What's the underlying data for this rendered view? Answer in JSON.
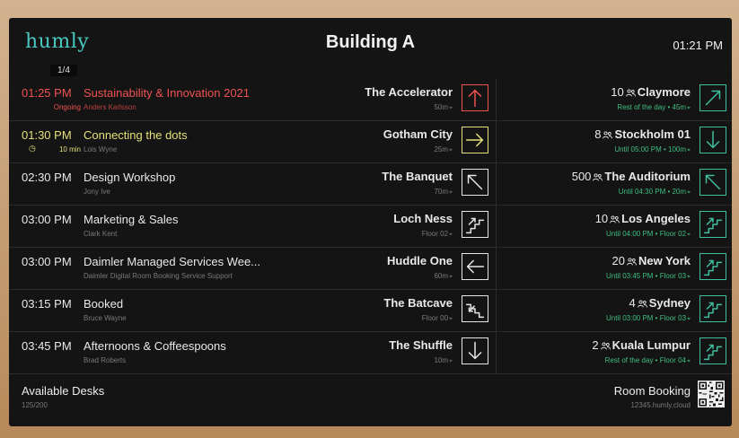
{
  "header": {
    "logo": "humly",
    "title": "Building A",
    "clock": "01:21 PM",
    "pager": "1/4"
  },
  "events": [
    {
      "time": "01:25 PM",
      "title": "Sustainability & Innovation 2021",
      "status": "Ongoing",
      "organizer": "Anders Karlsson",
      "room": "The Accelerator",
      "room_info": "50m",
      "arrow": "up",
      "state": "ongoing"
    },
    {
      "time": "01:30 PM",
      "title": "Connecting the dots",
      "status": "10 min",
      "organizer": "Lois Wyne",
      "room": "Gotham City",
      "room_info": "25m",
      "arrow": "right",
      "state": "soon"
    },
    {
      "time": "02:30 PM",
      "title": "Design Workshop",
      "status": "",
      "organizer": "Jony Ive",
      "room": "The Banquet",
      "room_info": "70m",
      "arrow": "up-left",
      "state": "normal"
    },
    {
      "time": "03:00 PM",
      "title": "Marketing & Sales",
      "status": "",
      "organizer": "Clark Kent",
      "room": "Loch Ness",
      "room_info": "Floor 02",
      "arrow": "stairs-up",
      "state": "normal"
    },
    {
      "time": "03:00 PM",
      "title": "Daimler Managed Services Wee...",
      "status": "",
      "organizer": "Daimler Digital Room Booking Service Support",
      "room": "Huddle One",
      "room_info": "60m",
      "arrow": "left",
      "state": "normal"
    },
    {
      "time": "03:15 PM",
      "title": "Booked",
      "status": "",
      "organizer": "Bruce Wayne",
      "room": "The Batcave",
      "room_info": "Floor 00",
      "arrow": "stairs-down",
      "state": "normal"
    },
    {
      "time": "03:45 PM",
      "title": "Afternoons & Coffeespoons",
      "status": "",
      "organizer": "Brad Roberts",
      "room": "The Shuffle",
      "room_info": "10m",
      "arrow": "down",
      "state": "normal"
    }
  ],
  "rooms": [
    {
      "capacity": "10",
      "name": "Claymore",
      "availability": "Rest of the day • 45m",
      "arrow": "up-right"
    },
    {
      "capacity": "8",
      "name": "Stockholm 01",
      "availability": "Until 05:00 PM • 100m",
      "arrow": "down"
    },
    {
      "capacity": "500",
      "name": "The Auditorium",
      "availability": "Until 04:30 PM • 20m",
      "arrow": "up-left"
    },
    {
      "capacity": "10",
      "name": "Los Angeles",
      "availability": "Until 04:00 PM • Floor 02",
      "arrow": "stairs-up"
    },
    {
      "capacity": "20",
      "name": "New York",
      "availability": "Until 03:45 PM • Floor 03",
      "arrow": "stairs-up"
    },
    {
      "capacity": "4",
      "name": "Sydney",
      "availability": "Until 03:00 PM • Floor 03",
      "arrow": "stairs-up"
    },
    {
      "capacity": "2",
      "name": "Kuala Lumpur",
      "availability": "Rest of the day • Floor 04",
      "arrow": "stairs-up"
    }
  ],
  "footer": {
    "desks_label": "Available Desks",
    "desks_value": "125/200",
    "booking_label": "Room Booking",
    "booking_url": "12345.humly.cloud"
  },
  "colors": {
    "ongoing": "#ef5350",
    "soon": "#e6e07a",
    "available": "#3fbf7f",
    "accent": "#48c8c0"
  }
}
